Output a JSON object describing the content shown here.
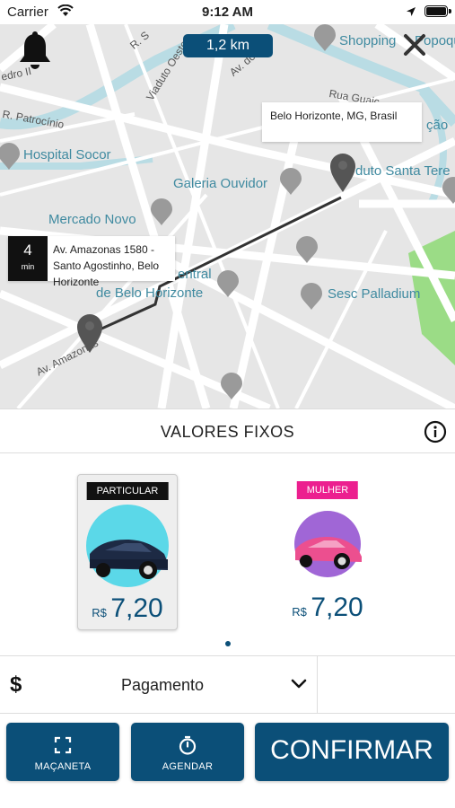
{
  "status_bar": {
    "carrier": "Carrier",
    "time": "9:12 AM"
  },
  "map": {
    "distance": "1,2 km",
    "destination_address": "Belo Horizonte, MG, Brasil",
    "origin_eta_value": "4",
    "origin_eta_unit": "min",
    "origin_address": "Av. Amazonas 1580 - Santo Agostinho, Belo Horizonte",
    "places": {
      "shopping": "Shopping",
      "shopping_suffix": "Popoqu",
      "hospital": "Hospital Socor",
      "galeria": "Galeria Ouvidor",
      "mercado": "Mercado Novo",
      "central_a": "entral",
      "central_b": "de Belo Horizonte",
      "sesc": "Sesc Palladium",
      "viaduto_santa": "duto Santa Tere",
      "cao": "ção"
    },
    "streets": {
      "viaduto_oeste": "Viaduto Oeste",
      "av_amazonas": "Av. Amazonas",
      "patrocinio": "R. Patrocínio",
      "rua_guai": "Rua Guaic",
      "pedro": "edro II",
      "av_do": "Av. do",
      "rua_s": "R. S"
    }
  },
  "fixed_values": {
    "title": "VALORES FIXOS"
  },
  "options": [
    {
      "badge": "PARTICULAR",
      "currency": "R$",
      "price": "7,20",
      "badge_color": "#111111",
      "car_bg": "#5bd8e8",
      "car_color": "#1d2a44"
    },
    {
      "badge": "MULHER",
      "currency": "R$",
      "price": "7,20",
      "badge_color": "#ec1f8f",
      "car_bg": "#a066d6",
      "car_color": "#ec4f8f"
    }
  ],
  "payment": {
    "icon": "$",
    "label": "Pagamento"
  },
  "buttons": {
    "macaneta": "MAÇANETA",
    "agendar": "AGENDAR",
    "confirmar": "CONFIRMAR"
  },
  "colors": {
    "primary": "#0b4f78",
    "pink": "#ec1f8f",
    "map_bg": "#e6e6e6"
  }
}
